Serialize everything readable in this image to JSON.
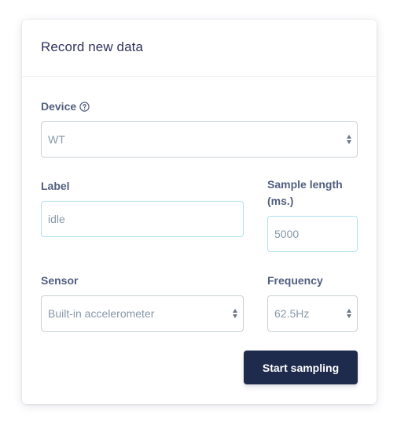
{
  "card": {
    "title": "Record new data"
  },
  "device": {
    "label": "Device",
    "value": "WT",
    "help_icon": "question-circle-icon"
  },
  "label_field": {
    "label": "Label",
    "value": "idle"
  },
  "sample_length": {
    "label_line1": "Sample length",
    "label_line2": "(ms.)",
    "value": "5000"
  },
  "sensor": {
    "label": "Sensor",
    "value": "Built-in accelerometer"
  },
  "frequency": {
    "label": "Frequency",
    "value": "62.5Hz"
  },
  "actions": {
    "start_label": "Start sampling"
  },
  "colors": {
    "primary_button": "#1f2b4d",
    "label_text": "#525f7f",
    "input_border": "#cad1d7",
    "input_focus_border": "#b2e0ee",
    "placeholder_text": "#8898aa"
  }
}
